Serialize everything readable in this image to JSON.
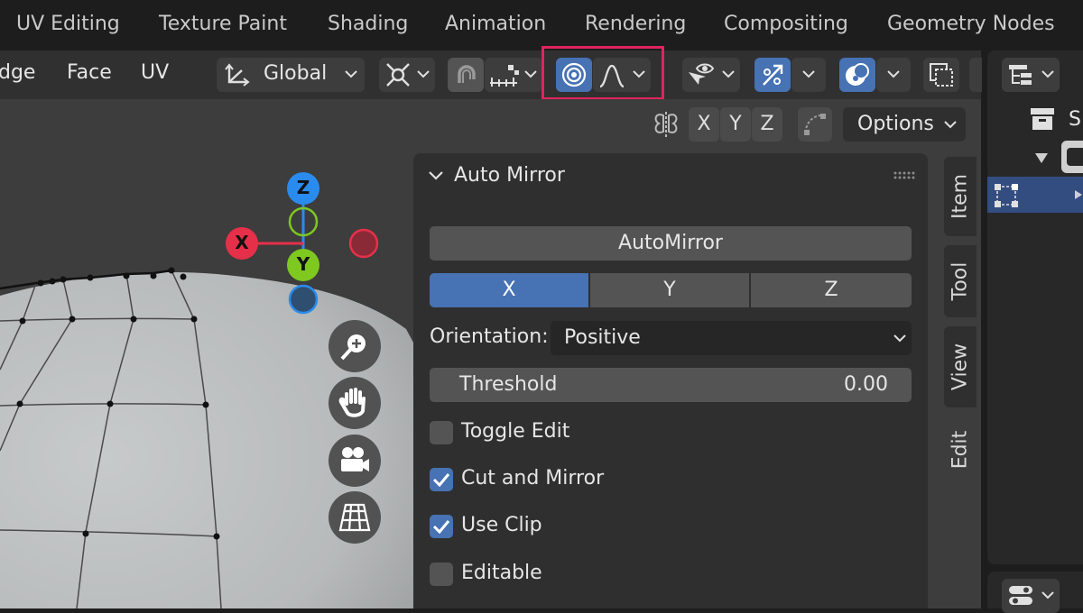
{
  "workspace_tabs": [
    "UV Editing",
    "Texture Paint",
    "Shading",
    "Animation",
    "Rendering",
    "Compositing",
    "Geometry Nodes"
  ],
  "header": {
    "menu": [
      "dge",
      "Face",
      "UV"
    ],
    "transform_orientation": "Global",
    "options_label": "Options",
    "mirror_axes": [
      "X",
      "Y",
      "Z"
    ]
  },
  "gizmo": {
    "z": "Z",
    "x": "X",
    "y": "Y"
  },
  "panel": {
    "title": "Auto Mirror",
    "automirror_button": "AutoMirror",
    "axes": [
      "X",
      "Y",
      "Z"
    ],
    "selected_axis": "X",
    "orientation_label": "Orientation:",
    "orientation_value": "Positive",
    "threshold_label": "Threshold",
    "threshold_value": "0.00",
    "checkboxes": [
      {
        "label": "Toggle Edit",
        "checked": false
      },
      {
        "label": "Cut and Mirror",
        "checked": true
      },
      {
        "label": "Use Clip",
        "checked": true
      },
      {
        "label": "Editable",
        "checked": false
      }
    ]
  },
  "sidebar_tabs": [
    "Item",
    "Tool",
    "View",
    "Edit"
  ],
  "active_sidebar_tab": "Edit",
  "outliner": {
    "partial_label": "S"
  },
  "colors": {
    "accent_blue": "#4772b3",
    "highlight_box": "#e0245e",
    "gizmo_x": "#e6304a",
    "gizmo_y": "#7ec820",
    "gizmo_z": "#2a8bef"
  }
}
